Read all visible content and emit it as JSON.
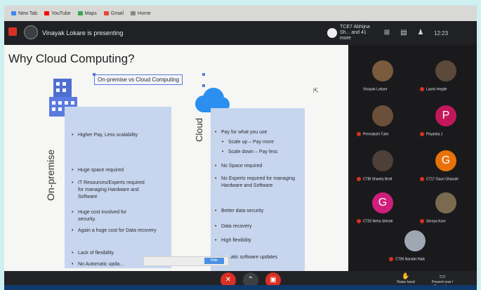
{
  "bookmarks": [
    {
      "label": "New Tab",
      "color": "#4285f4"
    },
    {
      "label": "YouTube",
      "color": "#ff0000"
    },
    {
      "label": "Maps",
      "color": "#34a853"
    },
    {
      "label": "Gmail",
      "color": "#ea4335"
    },
    {
      "label": "Home",
      "color": "#888888"
    }
  ],
  "meet": {
    "presenter": "Vinayak Lokare is presenting",
    "presenting_to": "TCE7 Abhijna Sh... and 41 more",
    "clock": "12:23",
    "accent": "#d93025"
  },
  "slide": {
    "title": "Why Cloud Computing?",
    "subtitle": "On-premise vs Cloud Computing",
    "onprem_label": "On-premise",
    "cloud_label": "Cloud",
    "onprem_bullets": [
      "Higher Pay, Less scalability",
      "Huge space required",
      "IT Resources/Experts required for managing Hardware and Software",
      "Huge cost involved for security.",
      "Again a huge cost for Data recovery",
      "Lack of flexibility",
      "No Automatic upda..."
    ],
    "cloud_bullets": [
      "Pay for what you use",
      "Scale up – Pay more",
      "Scale down – Pay less",
      "No Space required",
      "No Experts required for managing Hardware and Software",
      "Better data security",
      "Data recovery",
      "High flexibility",
      "...atic software updates"
    ]
  },
  "participants": [
    {
      "name": "Vinayak Lokare",
      "initial": "",
      "color": "#7a5b3e"
    },
    {
      "name": "Laxmi Hegde",
      "initial": "",
      "color": "#5b4a3a"
    },
    {
      "name": "Prernakshi Tuhe",
      "initial": "",
      "color": "#6b4f3a"
    },
    {
      "name": "Priyanka J",
      "initial": "P",
      "color": "#c2185b"
    },
    {
      "name": "CTIB Shweta Brett",
      "initial": "",
      "color": "#4d4038"
    },
    {
      "name": "CT17 Gauri Ghavale",
      "initial": "G",
      "color": "#e8710a"
    },
    {
      "name": "CT20 Neha Shinde",
      "initial": "G",
      "color": "#d01f7b"
    },
    {
      "name": "Shreya Kore",
      "initial": "",
      "color": "#7a6a50"
    },
    {
      "name": "CT06 Nandini Naik",
      "initial": "",
      "color": "#9fa7b3"
    }
  ],
  "bottom": {
    "raise_hand": "Raise hand",
    "present_now": "Present now / Presenting",
    "status_chip": "Hide"
  }
}
